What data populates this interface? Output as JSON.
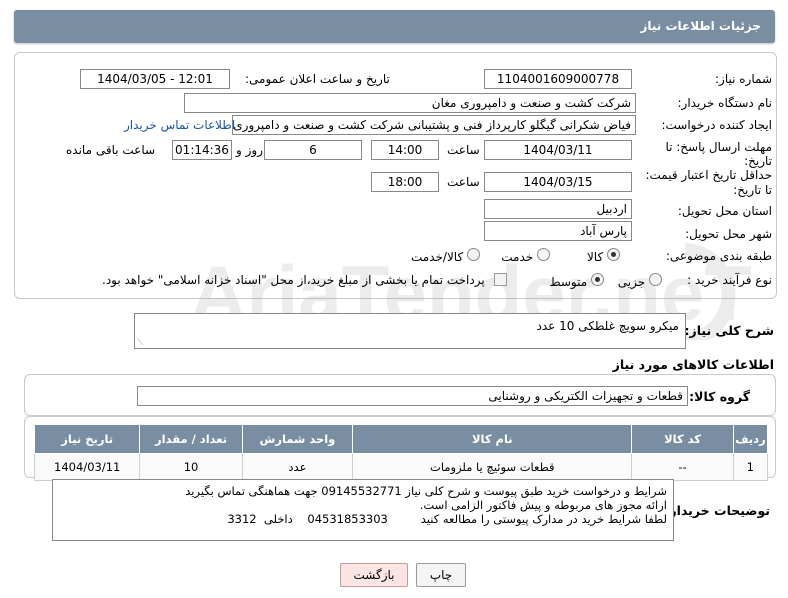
{
  "header": {
    "title": "جزئیات اطلاعات نیاز"
  },
  "form": {
    "need_number_label": "شماره نیاز:",
    "need_number": "1104001609000778",
    "announce_label": "تاریخ و ساعت اعلان عمومی:",
    "announce_value": "1404/03/05 - 12:01",
    "buyer_org_label": "نام دستگاه خریدار:",
    "buyer_org": "شرکت کشت و صنعت و دامپروری مغان",
    "creator_label": "ایجاد کننده درخواست:",
    "creator": "فیاض شکرانی گیگلو کارپرداز فنی و پشتیبانی شرکت کشت و صنعت و دامپروری",
    "contact_link": "اطلاعات تماس خریدار",
    "deadline_label_1": "مهلت ارسال پاسخ: تا",
    "deadline_label_2": "تاریخ:",
    "deadline_date": "1404/03/11",
    "time_label": "ساعت",
    "deadline_time": "14:00",
    "days_value": "6",
    "days_label": "روز و",
    "remaining_time": "01:14:36",
    "remaining_label": "ساعت باقی مانده",
    "validity_label_1": "حداقل تاریخ اعتبار قیمت:",
    "validity_label_2": "تا تاریخ:",
    "validity_date": "1404/03/15",
    "validity_time": "18:00",
    "province_label": "استان محل تحویل:",
    "province": "اردبیل",
    "city_label": "شهر محل تحویل:",
    "city": "پارس آباد",
    "category_label": "طبقه بندی موضوعی:",
    "category_options": [
      "کالا",
      "خدمت",
      "کالا/خدمت"
    ],
    "category_selected": "کالا",
    "process_label": "نوع فرآیند خرید :",
    "process_options": [
      "جزیی",
      "متوسط"
    ],
    "process_selected": "متوسط",
    "payment_note": "پرداخت تمام یا بخشی از مبلغ خرید،از محل \"اسناد خزانه اسلامی\" خواهد بود."
  },
  "description": {
    "label": "شرح کلی نیاز:",
    "value": "میکرو سویچ غلطکی 10 عدد"
  },
  "goods_section_title": "اطلاعات کالاهای مورد نیاز",
  "goods_group": {
    "label": "گروه کالا:",
    "value": "قطعات و تجهیزات الکتریکی و روشنایی"
  },
  "table": {
    "headers": [
      "ردیف",
      "کد کالا",
      "نام کالا",
      "واحد شمارش",
      "تعداد / مقدار",
      "تاریخ نیاز"
    ],
    "rows": [
      [
        "1",
        "--",
        "قطعات سوئیچ یا ملزومات",
        "عدد",
        "10",
        "1404/03/11"
      ]
    ]
  },
  "buyer_notes": {
    "label": "توضیحات خریدار:",
    "lines": [
      "شرایط و درخواست خرید طبق پیوست و شرح کلی نیاز 09145532771 جهت هماهنگی تماس بگیرید",
      "ارائه مجوز های مربوطه و پیش فاکتور الزامی است.",
      "لطفا شرایط خرید در مدارک پیوستی را مطالعه کنید         04531853303    داخلی  3312"
    ]
  },
  "buttons": {
    "print": "چاپ",
    "back": "بازگشت"
  },
  "watermark": {
    "text": "AriaTender.neT"
  },
  "colors": {
    "header_bg": "#7a8ea3",
    "link": "#1a55b0"
  }
}
